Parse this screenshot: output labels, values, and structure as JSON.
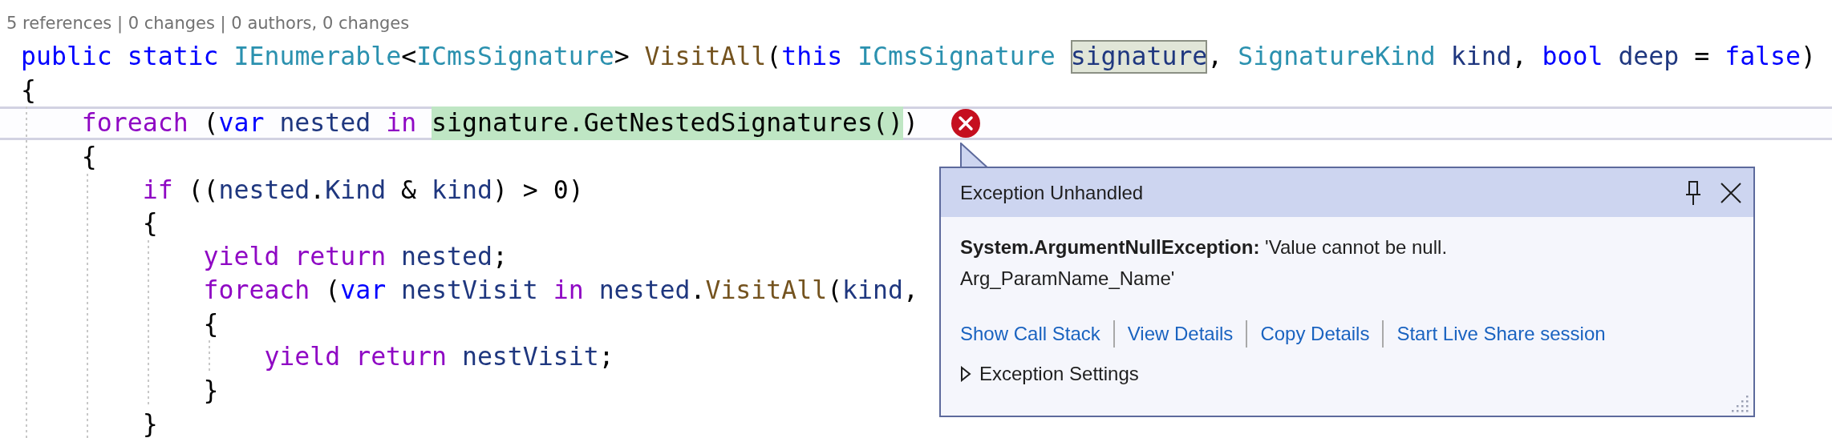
{
  "codelens": "5 references | 0 changes | 0 authors, 0 changes",
  "code_lines": [
    {
      "current": false,
      "error": false,
      "tokens": [
        {
          "text": "public ",
          "kind": "keyword"
        },
        {
          "text": "static ",
          "kind": "keyword"
        },
        {
          "text": "IEnumerable",
          "kind": "type"
        },
        {
          "text": "<",
          "kind": "plain"
        },
        {
          "text": "ICmsSignature",
          "kind": "type"
        },
        {
          "text": "> ",
          "kind": "plain"
        },
        {
          "text": "VisitAll",
          "kind": "method"
        },
        {
          "text": "(",
          "kind": "plain"
        },
        {
          "text": "this ",
          "kind": "keyword"
        },
        {
          "text": "ICmsSignature ",
          "kind": "type"
        },
        {
          "text": "signature",
          "kind": "boxed_reference"
        },
        {
          "text": ", ",
          "kind": "plain"
        },
        {
          "text": "SignatureKind ",
          "kind": "type"
        },
        {
          "text": "kind",
          "kind": "identifier"
        },
        {
          "text": ", ",
          "kind": "plain"
        },
        {
          "text": "bool ",
          "kind": "keyword"
        },
        {
          "text": "deep",
          "kind": "identifier"
        },
        {
          "text": " = ",
          "kind": "plain"
        },
        {
          "text": "false",
          "kind": "keyword"
        },
        {
          "text": ")",
          "kind": "plain"
        }
      ]
    },
    {
      "current": false,
      "error": false,
      "tokens": [
        {
          "text": "{",
          "kind": "plain"
        }
      ]
    },
    {
      "current": true,
      "error": true,
      "tokens": [
        {
          "text": "    foreach",
          "kind": "control"
        },
        {
          "text": " (",
          "kind": "plain"
        },
        {
          "text": "var ",
          "kind": "keyword"
        },
        {
          "text": "nested ",
          "kind": "identifier"
        },
        {
          "text": "in ",
          "kind": "control"
        },
        {
          "text": "signature.GetNestedSignatures()",
          "kind": "current_statement"
        },
        {
          "text": ")",
          "kind": "plain"
        }
      ]
    },
    {
      "current": false,
      "error": false,
      "tokens": [
        {
          "text": "    {",
          "kind": "plain"
        }
      ]
    },
    {
      "current": false,
      "error": false,
      "tokens": [
        {
          "text": "        if",
          "kind": "control"
        },
        {
          "text": " ((",
          "kind": "plain"
        },
        {
          "text": "nested",
          "kind": "identifier"
        },
        {
          "text": ".",
          "kind": "plain"
        },
        {
          "text": "Kind",
          "kind": "identifier"
        },
        {
          "text": " & ",
          "kind": "plain"
        },
        {
          "text": "kind",
          "kind": "identifier"
        },
        {
          "text": ") > 0)",
          "kind": "plain"
        }
      ]
    },
    {
      "current": false,
      "error": false,
      "tokens": [
        {
          "text": "        {",
          "kind": "plain"
        }
      ]
    },
    {
      "current": false,
      "error": false,
      "tokens": [
        {
          "text": "            yield return ",
          "kind": "control"
        },
        {
          "text": "nested",
          "kind": "identifier"
        },
        {
          "text": ";",
          "kind": "plain"
        }
      ]
    },
    {
      "current": false,
      "error": false,
      "tokens": [
        {
          "text": "            foreach",
          "kind": "control"
        },
        {
          "text": " (",
          "kind": "plain"
        },
        {
          "text": "var ",
          "kind": "keyword"
        },
        {
          "text": "nestVisit ",
          "kind": "identifier"
        },
        {
          "text": "in ",
          "kind": "control"
        },
        {
          "text": "nested",
          "kind": "identifier"
        },
        {
          "text": ".",
          "kind": "plain"
        },
        {
          "text": "VisitAll",
          "kind": "method"
        },
        {
          "text": "(",
          "kind": "plain"
        },
        {
          "text": "kind",
          "kind": "identifier"
        },
        {
          "text": ",",
          "kind": "plain"
        }
      ]
    },
    {
      "current": false,
      "error": false,
      "tokens": [
        {
          "text": "            {",
          "kind": "plain"
        }
      ]
    },
    {
      "current": false,
      "error": false,
      "tokens": [
        {
          "text": "                yield return ",
          "kind": "control"
        },
        {
          "text": "nestVisit",
          "kind": "identifier"
        },
        {
          "text": ";",
          "kind": "plain"
        }
      ]
    },
    {
      "current": false,
      "error": false,
      "tokens": [
        {
          "text": "            }",
          "kind": "plain"
        }
      ]
    },
    {
      "current": false,
      "error": false,
      "tokens": [
        {
          "text": "        }",
          "kind": "plain"
        }
      ]
    }
  ],
  "exception_popup": {
    "title": "Exception Unhandled",
    "message": "**System.ArgumentNullException:** 'Value cannot be null.\nArg_ParamName_Name'",
    "links": [
      "Show Call Stack",
      "View Details",
      "Copy Details",
      "Start Live Share session"
    ],
    "settings": {
      "label": "Exception Settings",
      "expanded": false
    }
  }
}
